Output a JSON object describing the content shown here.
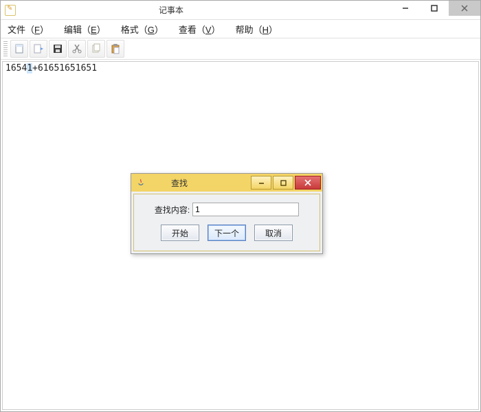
{
  "window": {
    "title": "记事本"
  },
  "menu": {
    "file": {
      "label": "文件",
      "key": "F"
    },
    "edit": {
      "label": "编辑",
      "key": "E"
    },
    "format": {
      "label": "格式",
      "key": "G"
    },
    "view": {
      "label": "查看",
      "key": "V"
    },
    "help": {
      "label": "帮助",
      "key": "H"
    }
  },
  "toolbar": {
    "new_name": "new-icon",
    "open_name": "open-icon",
    "save_name": "save-icon",
    "cut_name": "cut-icon",
    "copy_name": "copy-icon",
    "paste_name": "paste-icon"
  },
  "editor": {
    "content_before_sel": "1654",
    "content_sel": "1",
    "content_after_sel": "+61651651651"
  },
  "dialog": {
    "title": "查找",
    "label": "查找内容:",
    "input_value": "1",
    "buttons": {
      "start": "开始",
      "next": "下一个",
      "cancel": "取消"
    }
  }
}
